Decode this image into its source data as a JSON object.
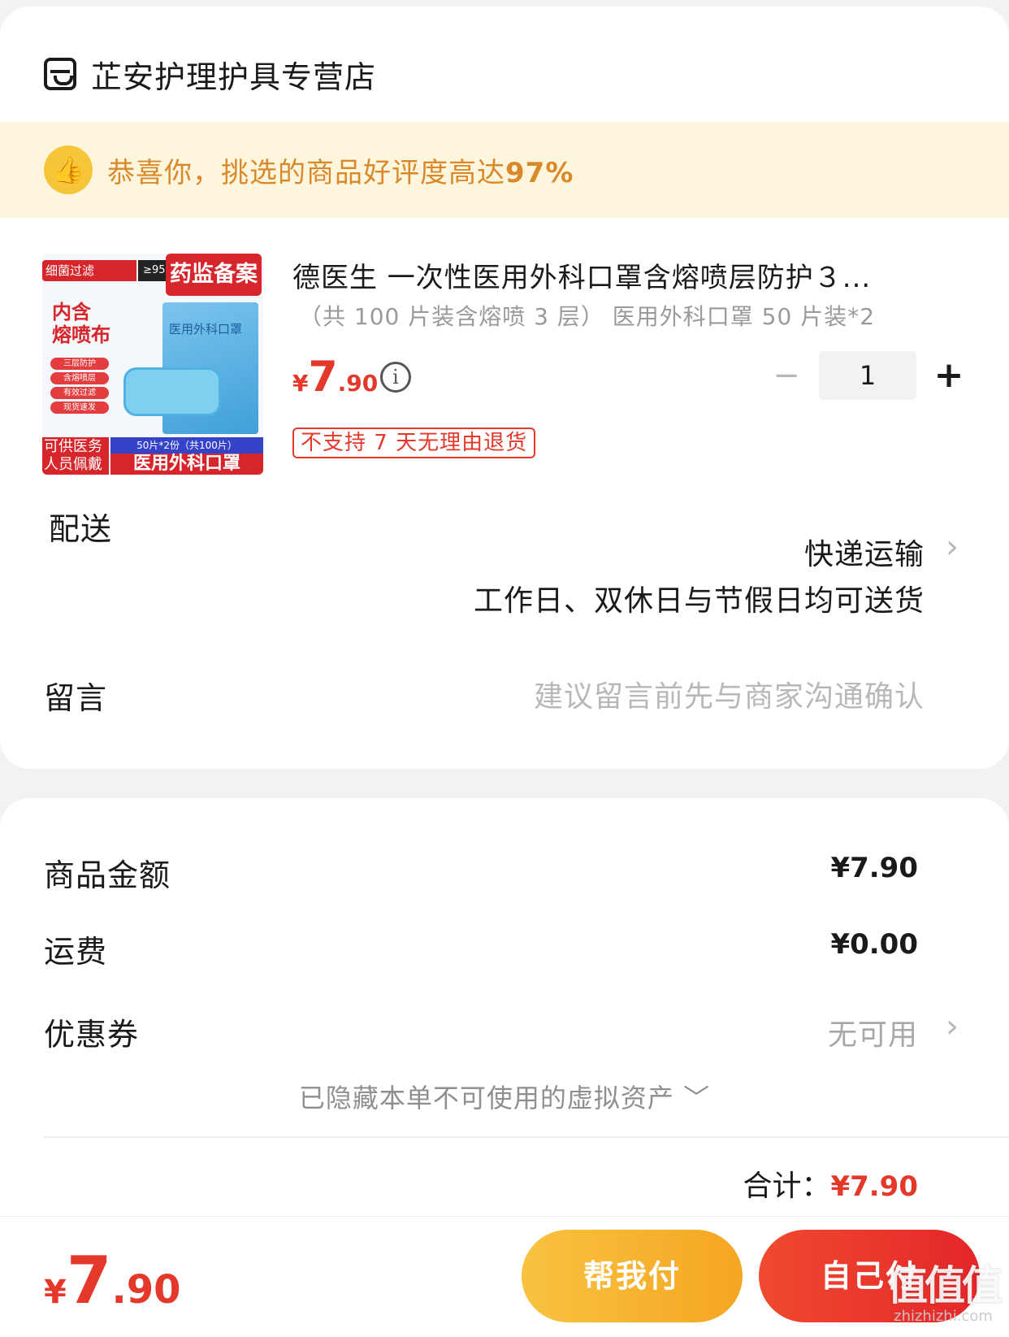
{
  "store": {
    "name": "芷安护理护具专营店"
  },
  "praise": {
    "text": "恭喜你，挑选的商品好评度高达",
    "rate": "97%"
  },
  "product": {
    "thumb": {
      "tag_filter": "细菌过滤",
      "tag_filter_value": "≥95%",
      "tag_reg": "药监备案",
      "inner_line1": "内含",
      "inner_line2": "熔喷布",
      "checks": [
        "三层防护",
        "含熔喷层",
        "有效过滤",
        "现货速发"
      ],
      "pack_title": "医用外科口罩",
      "bottom_left": "可供医务人员佩戴",
      "bottom_qty": "50片*2份（共100片）",
      "bottom_name": "医用外科口罩"
    },
    "title": "德医生 一次性医用外科口罩含熔喷层防护３...",
    "spec": "（共 100 片装含熔喷 3 层） 医用外科口罩 50 片装*2",
    "price_symbol": "¥",
    "price_int": "7",
    "price_dec": ".90",
    "info_icon": "i",
    "quantity": "1",
    "minus": "−",
    "plus": "+",
    "return_policy": "不支持 7 天无理由退货"
  },
  "delivery": {
    "label": "配送",
    "method": "快递运输",
    "note": "工作日、双休日与节假日均可送货"
  },
  "remark": {
    "label": "留言",
    "placeholder": "建议留言前先与商家沟通确认"
  },
  "summary": {
    "goods_label": "商品金额",
    "goods_value": "¥7.90",
    "shipping_label": "运费",
    "shipping_value": "¥0.00",
    "coupon_label": "优惠券",
    "coupon_value": "无可用",
    "hidden_assets": "已隐藏本单不可使用的虚拟资产 ﹀",
    "total_label": "合计：",
    "total_value": "¥7.90"
  },
  "bottom_bar": {
    "price_symbol": "¥",
    "price_int": "7",
    "price_dec": ".90",
    "help_pay": "帮我付",
    "self_pay": "自己付"
  },
  "watermark": {
    "logo": "值值值",
    "url": "zhizhizhi.com"
  },
  "icons": {
    "store": "store-icon",
    "praise": "thumbs-up-icon",
    "chevron": "chevron-right-icon"
  },
  "colors": {
    "accent_red": "#e4382b",
    "praise_bg": "#fdf6dd",
    "praise_text": "#d9892b",
    "help_button": "#f5a623",
    "self_button": "#e4262a"
  }
}
